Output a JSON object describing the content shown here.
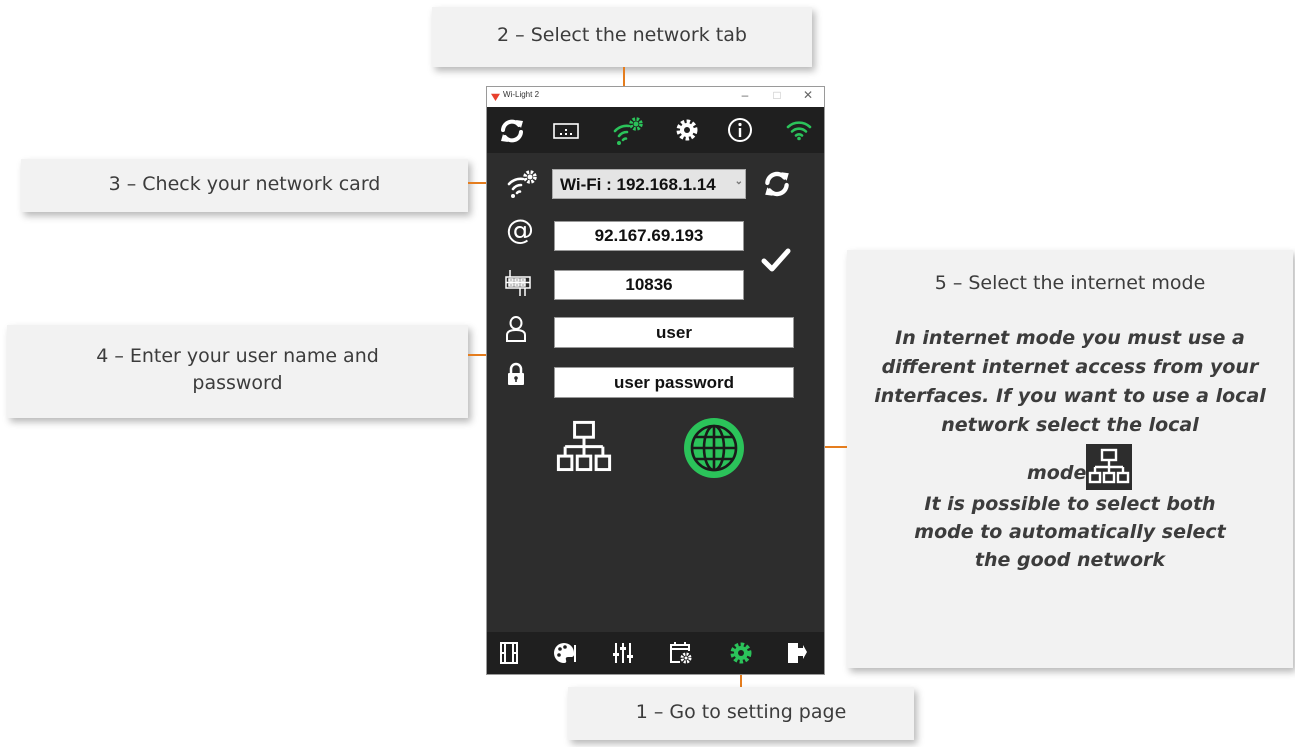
{
  "window": {
    "title": "Wi-Light 2",
    "minimize": "–",
    "maximize": "□",
    "close": "✕"
  },
  "top_tabs": [
    {
      "icon": "refresh-icon",
      "active": false
    },
    {
      "icon": "keyboard-icon",
      "active": false
    },
    {
      "icon": "network-tab-icon",
      "active": true
    },
    {
      "icon": "gear-icon",
      "active": false
    },
    {
      "icon": "info-icon",
      "active": false
    },
    {
      "icon": "wifi-status-icon",
      "active": true
    }
  ],
  "network": {
    "card_select_value": "Wi-Fi : 192.168.1.14",
    "ip_address": "92.167.69.193",
    "port": "10836",
    "username": "user",
    "password": "user password"
  },
  "bottom_nav": [
    {
      "icon": "film-icon",
      "active": false
    },
    {
      "icon": "palette-icon",
      "active": false
    },
    {
      "icon": "mixer-sliders-icon",
      "active": false
    },
    {
      "icon": "calendar-settings-icon",
      "active": false
    },
    {
      "icon": "settings-gear-icon",
      "active": true
    },
    {
      "icon": "exit-door-icon",
      "active": false
    }
  ],
  "colors": {
    "accent_green": "#2bc35a",
    "callout_line_orange": "#e57d1e",
    "app_background": "#2d2d2d",
    "bar_background": "#1f1f1f"
  },
  "callouts": {
    "step1": "1 – Go to setting page",
    "step2": "2 – Select the network tab",
    "step3": "3 – Check your network card",
    "step4": "4 – Enter your user name and password",
    "step5_title": "5 – Select the internet mode",
    "step5_body": "In internet mode you must use a different internet access from your interfaces. If you want to use a local network select the local",
    "step5_mode": "mode",
    "step5_footer": "It is possible to select both mode to automatically select the good network"
  }
}
